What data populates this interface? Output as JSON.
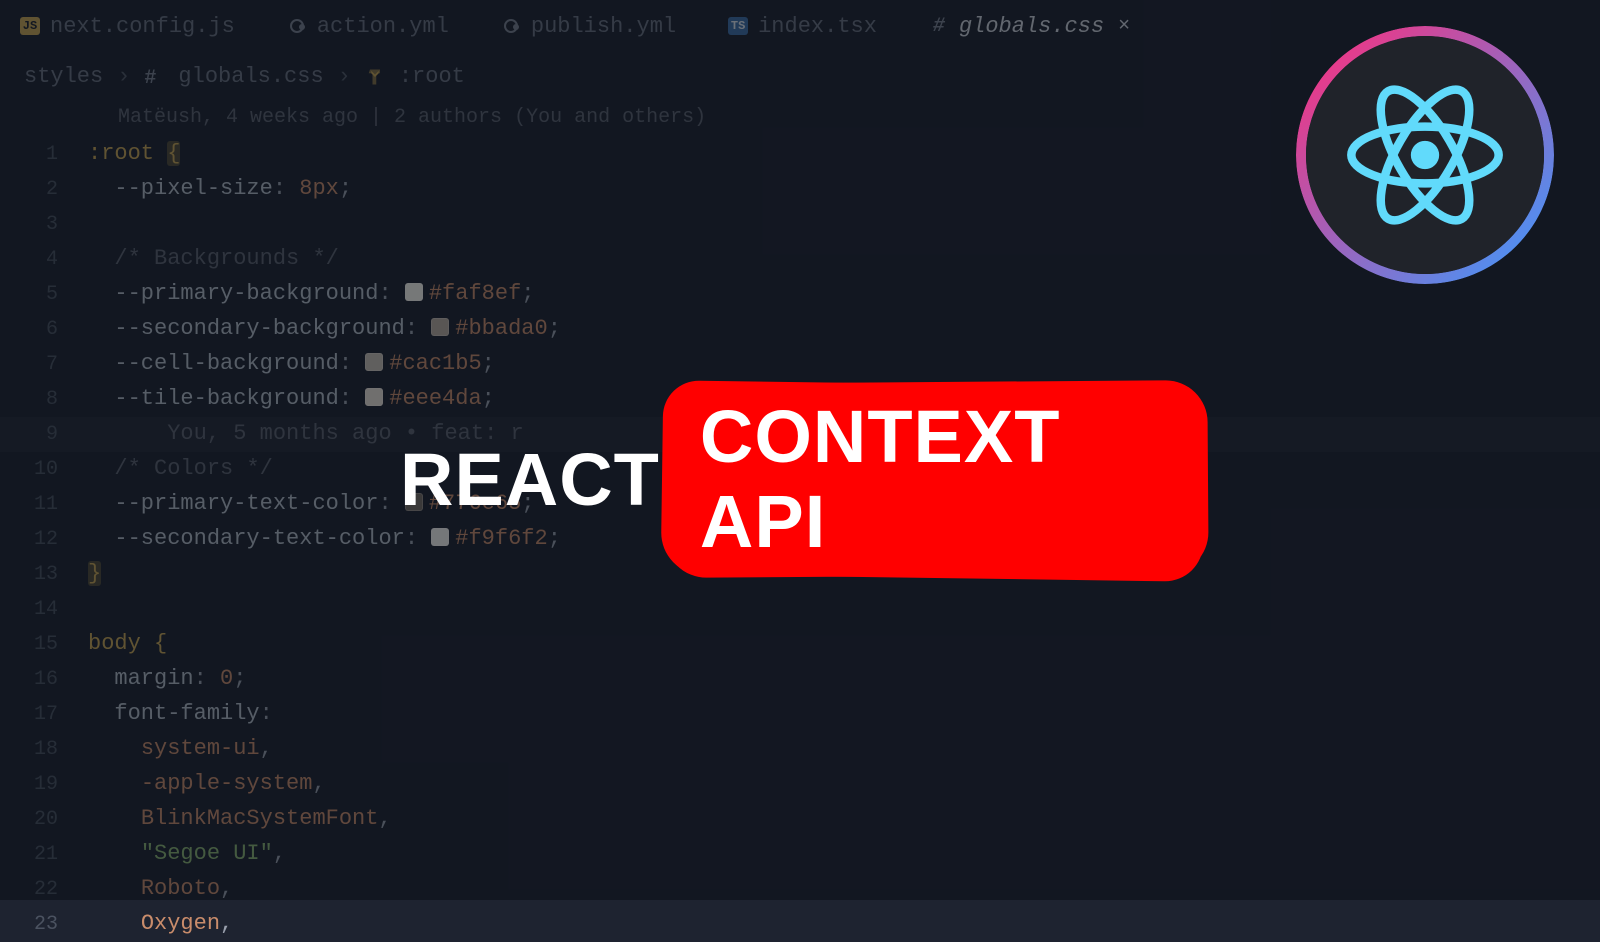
{
  "tabs": [
    {
      "icon": "js",
      "label": "next.config.js",
      "active": false
    },
    {
      "icon": "yml",
      "label": "action.yml",
      "active": false
    },
    {
      "icon": "yml",
      "label": "publish.yml",
      "active": false
    },
    {
      "icon": "ts",
      "label": "index.tsx",
      "active": false
    },
    {
      "icon": "hash",
      "label": "globals.css",
      "active": true
    }
  ],
  "breadcrumbs": {
    "folder": "styles",
    "file": "globals.css",
    "symbol": ":root"
  },
  "blame": "Matëush, 4 weeks ago | 2 authors (You and others)",
  "code": {
    "lines": [
      {
        "n": 1,
        "tokens": [
          {
            "t": ":root ",
            "c": "c-sel"
          },
          {
            "t": "{",
            "c": "c-brace-hl"
          }
        ]
      },
      {
        "n": 2,
        "indent": 1,
        "tokens": [
          {
            "t": "--pixel-size",
            "c": "c-prop"
          },
          {
            "t": ": ",
            "c": ""
          },
          {
            "t": "8px",
            "c": "c-num"
          },
          {
            "t": ";",
            "c": ""
          }
        ]
      },
      {
        "n": 3,
        "tokens": []
      },
      {
        "n": 4,
        "indent": 1,
        "tokens": [
          {
            "t": "/* Backgrounds */",
            "c": "c-comment"
          }
        ]
      },
      {
        "n": 5,
        "indent": 1,
        "tokens": [
          {
            "t": "--primary-background",
            "c": "c-prop"
          },
          {
            "t": ": ",
            "c": ""
          },
          {
            "swatch": "#faf8ef"
          },
          {
            "t": "#faf8ef",
            "c": "c-num"
          },
          {
            "t": ";",
            "c": ""
          }
        ]
      },
      {
        "n": 6,
        "indent": 1,
        "tokens": [
          {
            "t": "--secondary-background",
            "c": "c-prop"
          },
          {
            "t": ": ",
            "c": ""
          },
          {
            "swatch": "#bbada0"
          },
          {
            "t": "#bbada0",
            "c": "c-num"
          },
          {
            "t": ";",
            "c": ""
          }
        ]
      },
      {
        "n": 7,
        "indent": 1,
        "tokens": [
          {
            "t": "--cell-background",
            "c": "c-prop"
          },
          {
            "t": ": ",
            "c": ""
          },
          {
            "swatch": "#cac1b5"
          },
          {
            "t": "#cac1b5",
            "c": "c-num"
          },
          {
            "t": ";",
            "c": ""
          }
        ]
      },
      {
        "n": 8,
        "indent": 1,
        "tokens": [
          {
            "t": "--tile-background",
            "c": "c-prop"
          },
          {
            "t": ": ",
            "c": ""
          },
          {
            "swatch": "#eee4da"
          },
          {
            "t": "#eee4da",
            "c": "c-num"
          },
          {
            "t": ";",
            "c": ""
          }
        ]
      },
      {
        "n": 9,
        "hl": true,
        "indent": 3,
        "tokens": [
          {
            "t": "You, 5 months ago • feat: r",
            "c": "c-comment"
          }
        ]
      },
      {
        "n": 10,
        "indent": 1,
        "tokens": [
          {
            "t": "/* Colors */",
            "c": "c-comment"
          }
        ]
      },
      {
        "n": 11,
        "indent": 1,
        "tokens": [
          {
            "t": "--primary-text-color",
            "c": "c-prop"
          },
          {
            "t": ": ",
            "c": ""
          },
          {
            "swatch": "#776e65"
          },
          {
            "t": "#776e65",
            "c": "c-num"
          },
          {
            "t": ";",
            "c": ""
          }
        ]
      },
      {
        "n": 12,
        "indent": 1,
        "tokens": [
          {
            "t": "--secondary-text-color",
            "c": "c-prop"
          },
          {
            "t": ": ",
            "c": ""
          },
          {
            "swatch": "#f9f6f2"
          },
          {
            "t": "#f9f6f2",
            "c": "c-num"
          },
          {
            "t": ";",
            "c": ""
          }
        ]
      },
      {
        "n": 13,
        "tokens": [
          {
            "t": "}",
            "c": "c-brace-hl"
          }
        ]
      },
      {
        "n": 14,
        "tokens": []
      },
      {
        "n": 15,
        "tokens": [
          {
            "t": "body ",
            "c": "c-sel"
          },
          {
            "t": "{",
            "c": "c-brace"
          }
        ]
      },
      {
        "n": 16,
        "indent": 1,
        "tokens": [
          {
            "t": "margin",
            "c": "c-prop"
          },
          {
            "t": ": ",
            "c": ""
          },
          {
            "t": "0",
            "c": "c-num"
          },
          {
            "t": ";",
            "c": ""
          }
        ]
      },
      {
        "n": 17,
        "indent": 1,
        "tokens": [
          {
            "t": "font-family",
            "c": "c-prop"
          },
          {
            "t": ":",
            "c": ""
          }
        ]
      },
      {
        "n": 18,
        "indent": 2,
        "tokens": [
          {
            "t": "system-ui",
            "c": "c-num"
          },
          {
            "t": ",",
            "c": ""
          }
        ]
      },
      {
        "n": 19,
        "indent": 2,
        "tokens": [
          {
            "t": "-apple-system",
            "c": "c-num"
          },
          {
            "t": ",",
            "c": ""
          }
        ]
      },
      {
        "n": 20,
        "indent": 2,
        "tokens": [
          {
            "t": "BlinkMacSystemFont",
            "c": "c-num"
          },
          {
            "t": ",",
            "c": ""
          }
        ]
      },
      {
        "n": 21,
        "indent": 2,
        "tokens": [
          {
            "t": "\"Segoe UI\"",
            "c": "c-str"
          },
          {
            "t": ",",
            "c": ""
          }
        ]
      },
      {
        "n": 22,
        "indent": 2,
        "tokens": [
          {
            "t": "Roboto",
            "c": "c-num"
          },
          {
            "t": ",",
            "c": ""
          }
        ]
      },
      {
        "n": 23,
        "indent": 2,
        "tokens": [
          {
            "t": "Oxygen",
            "c": "c-num"
          },
          {
            "t": ",",
            "c": ""
          }
        ]
      }
    ]
  },
  "title": {
    "word1": "REACT",
    "word2": "CONTEXT API"
  },
  "badge": {
    "ring_start": "#ff2d7a",
    "ring_end": "#3a9bff",
    "react_color": "#61dafb"
  }
}
